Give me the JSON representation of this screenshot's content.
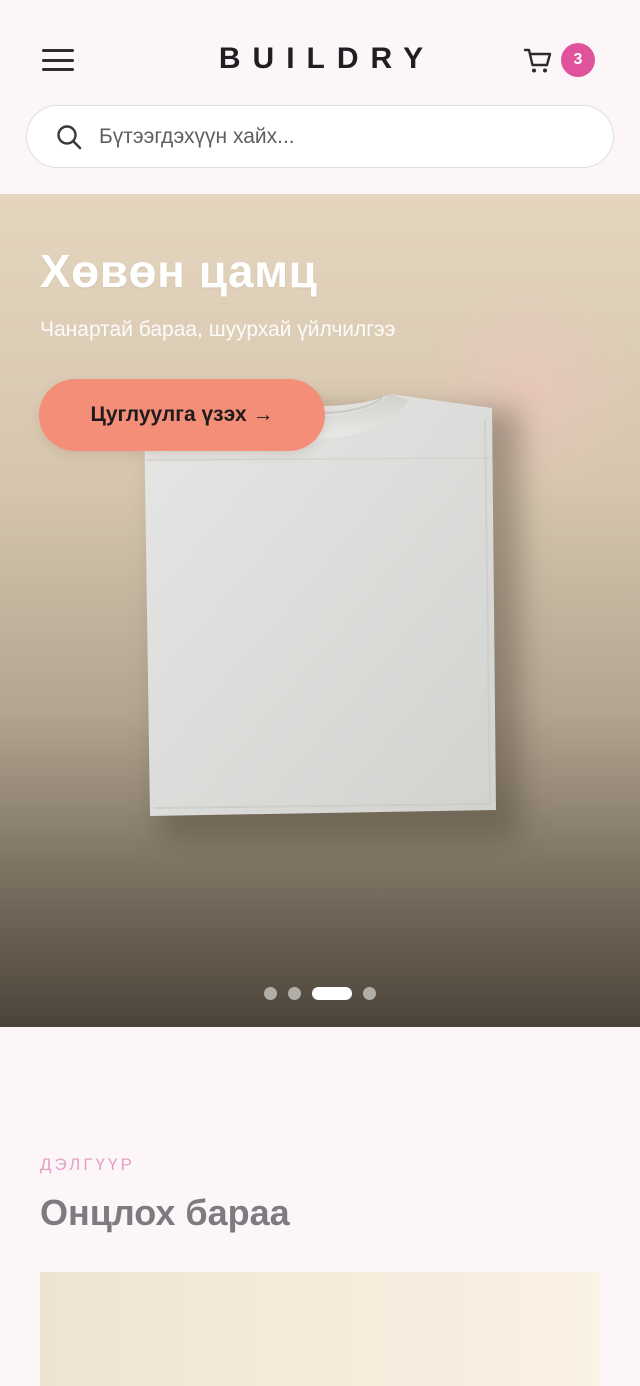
{
  "header": {
    "logo": "BUILDRY",
    "cart_count": "3"
  },
  "search": {
    "placeholder": "Бүтээгдэхүүн хайх..."
  },
  "hero": {
    "title": "Хөвөн цамц",
    "subtitle": "Чанартай бараа, шуурхай үйлчилгээ",
    "cta_label": "Цуглуулга үзэх →",
    "slide_count": 4,
    "active_slide": 3
  },
  "featured": {
    "kicker": "ДЭЛГҮҮР",
    "title": "Онцлох бараа"
  },
  "icons": {
    "menu": "menu-icon",
    "cart": "cart-icon",
    "search": "search-icon"
  },
  "colors": {
    "background": "#fcf6f9",
    "badge": "#e0529c",
    "cta": "#f48e78",
    "kicker": "#e59fc6"
  }
}
